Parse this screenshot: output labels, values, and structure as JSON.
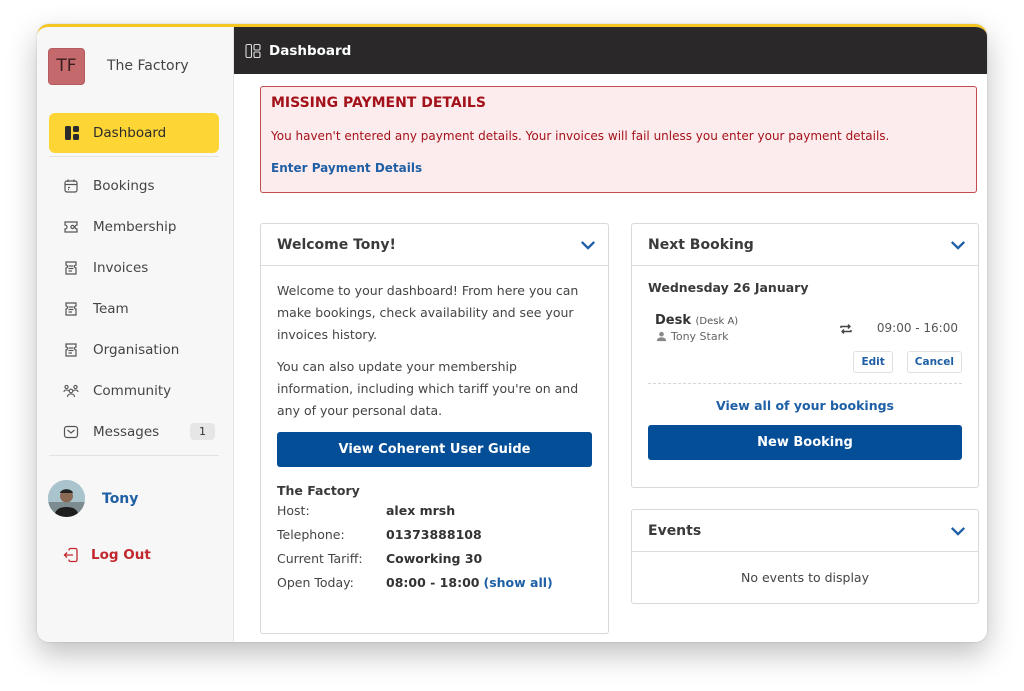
{
  "brand": {
    "initials": "TF",
    "name": "The Factory",
    "logo_color": "#c46a6d"
  },
  "sidebar": {
    "active": {
      "label": "Dashboard",
      "icon": "dashboard-icon"
    },
    "items": [
      {
        "label": "Bookings",
        "icon": "calendar-icon"
      },
      {
        "label": "Membership",
        "icon": "ticket-icon"
      },
      {
        "label": "Invoices",
        "icon": "receipt-icon"
      },
      {
        "label": "Team",
        "icon": "receipt-icon"
      },
      {
        "label": "Organisation",
        "icon": "receipt-icon"
      },
      {
        "label": "Community",
        "icon": "people-icon"
      },
      {
        "label": "Messages",
        "icon": "inbox-icon",
        "badge": "1"
      }
    ],
    "user": {
      "name": "Tony"
    },
    "logout": {
      "label": "Log Out",
      "icon": "logout-icon"
    }
  },
  "topbar": {
    "title": "Dashboard",
    "icon": "layout-icon"
  },
  "alert": {
    "title": "MISSING PAYMENT DETAILS",
    "text": "You haven't entered any payment details. Your invoices will fail unless you enter your payment details.",
    "link": "Enter Payment Details"
  },
  "welcome": {
    "title": "Welcome Tony!",
    "paragraph1": "Welcome to your dashboard! From here you can make bookings, check availability and see your invoices history.",
    "paragraph2": "You can also update your membership information, including which tariff you're on and any of your personal data.",
    "button": "View Coherent User Guide",
    "info_title": "The Factory",
    "info": [
      {
        "key": "Host:",
        "value": "alex mrsh"
      },
      {
        "key": "Telephone:",
        "value": "01373888108"
      },
      {
        "key": "Current Tariff:",
        "value": "Coworking 30"
      },
      {
        "key": "Open Today:",
        "value": "08:00 - 18:00",
        "link": "(show all)"
      }
    ]
  },
  "next_booking": {
    "title": "Next Booking",
    "date": "Wednesday 26 January",
    "resource": "Desk",
    "resource_detail": "(Desk A)",
    "person": "Tony Stark",
    "time": "09:00 - 16:00",
    "edit": "Edit",
    "cancel": "Cancel",
    "view_all": "View all of your bookings",
    "new_booking": "New Booking"
  },
  "events": {
    "title": "Events",
    "empty": "No events to display"
  },
  "colors": {
    "accent_yellow": "#fdd535",
    "primary_blue": "#044e97",
    "link_blue": "#1e5fa5",
    "alert_red": "#a3121a",
    "topbar": "#2a2828"
  }
}
